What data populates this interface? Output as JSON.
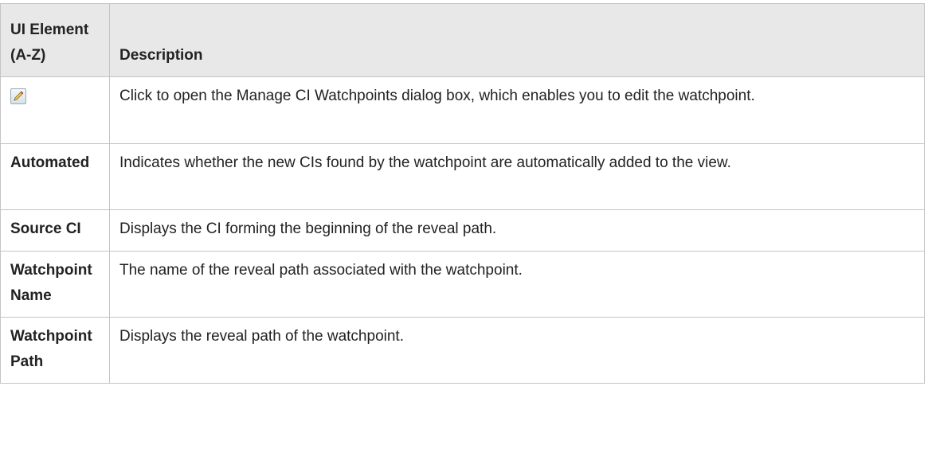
{
  "table": {
    "headers": {
      "element": "UI Element (A-Z)",
      "description": "Description"
    },
    "rows": [
      {
        "element": "",
        "icon": "edit-pencil-icon",
        "description": "Click to open the Manage CI Watchpoints dialog box, which enables you to edit the watchpoint."
      },
      {
        "element": "Automated",
        "description": "Indicates whether the new CIs found by the watchpoint are automatically added to the view."
      },
      {
        "element": "Source CI",
        "description": "Displays the CI forming the beginning of the reveal path."
      },
      {
        "element": "Watchpoint Name",
        "description": "The name of the reveal path associated with the watchpoint."
      },
      {
        "element": "Watchpoint Path",
        "description": "Displays the reveal path of the watchpoint."
      }
    ]
  },
  "colors": {
    "header_bg": "#e8e8e8",
    "border": "#c4c4c4",
    "text": "#222222"
  }
}
